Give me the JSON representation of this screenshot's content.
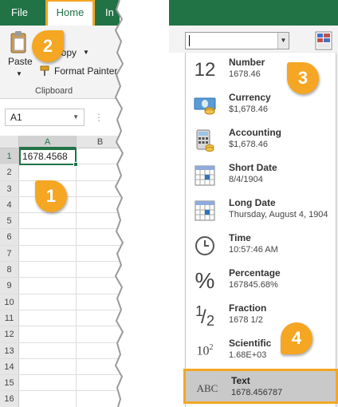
{
  "ribbon": {
    "tabs": [
      "File",
      "Home",
      "In"
    ],
    "active_tab": "Home",
    "clipboard": {
      "paste_label": "Paste",
      "cut_label": "ut",
      "copy_label": "Copy",
      "format_painter_label": "Format Painter",
      "group_label": "Clipboard"
    }
  },
  "name_box": {
    "value": "A1"
  },
  "formula_bar": {
    "separator": "⋮"
  },
  "sheet": {
    "columns": [
      "A",
      "B"
    ],
    "rows": [
      "1",
      "2",
      "3",
      "4",
      "5",
      "6",
      "7",
      "8",
      "9",
      "10",
      "11",
      "12",
      "13",
      "14",
      "15",
      "16"
    ],
    "selected_cell": "A1",
    "a1_value": "1678.4568"
  },
  "number_format": {
    "current_value": "",
    "options": [
      {
        "name": "Number",
        "example": "1678.46",
        "icon": "number-12-icon"
      },
      {
        "name": "Currency",
        "example": "$1,678.46",
        "icon": "currency-icon"
      },
      {
        "name": "Accounting",
        "example": " $1,678.46",
        "icon": "accounting-calculator-icon"
      },
      {
        "name": "Short Date",
        "example": "8/4/1904",
        "icon": "short-date-calendar-icon"
      },
      {
        "name": "Long Date",
        "example": "Thursday, August 4, 1904",
        "icon": "long-date-calendar-icon"
      },
      {
        "name": "Time",
        "example": "10:57:46 AM",
        "icon": "clock-icon"
      },
      {
        "name": "Percentage",
        "example": "167845.68%",
        "icon": "percent-icon"
      },
      {
        "name": "Fraction",
        "example": "1678 1/2",
        "icon": "fraction-icon"
      },
      {
        "name": "Scientific",
        "example": "1.68E+03",
        "icon": "scientific-icon"
      },
      {
        "name": "Text",
        "example": "1678.456787",
        "icon": "abc-text-icon"
      }
    ],
    "highlighted_option": "Text",
    "icon_glyphs": {
      "number": "12",
      "percent": "%",
      "fraction_num": "1",
      "fraction_den": "2",
      "sci_base": "10",
      "sci_exp": "2",
      "text": "ABC"
    }
  },
  "callouts": [
    "1",
    "2",
    "3",
    "4"
  ],
  "colors": {
    "excel_green": "#217346",
    "callout_orange": "#f5a623",
    "highlight_gray": "#c9c9c9"
  }
}
